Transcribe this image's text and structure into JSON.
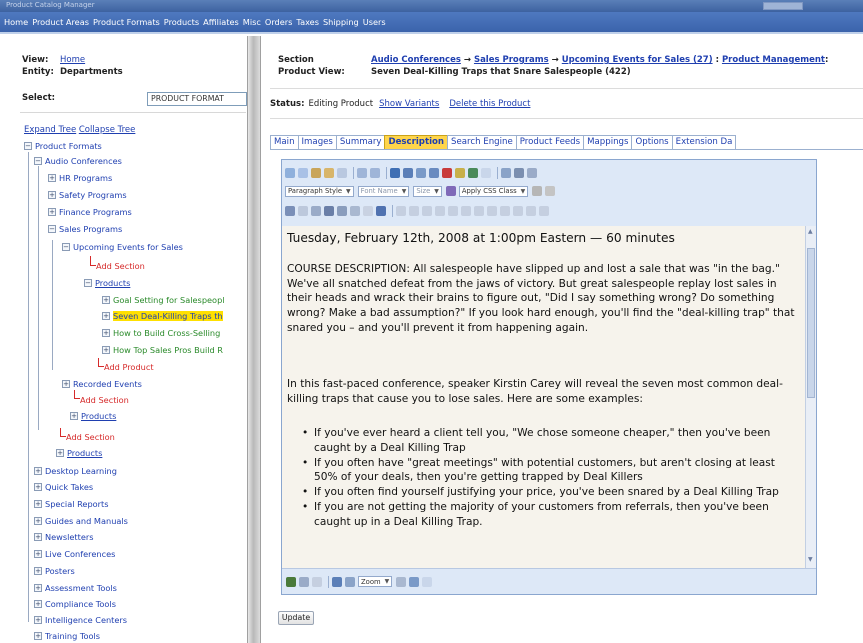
{
  "topbar": {
    "faint_text": "Product Catalog Manager"
  },
  "nav": [
    "Home",
    "Product Areas",
    "Product Formats",
    "Products",
    "Affiliates",
    "Misc",
    "Orders",
    "Taxes",
    "Shipping",
    "Users"
  ],
  "left": {
    "view_label": "View:",
    "view_value": "Home",
    "entity_label": "Entity:",
    "entity_value": "Departments",
    "select_label": "Select:",
    "select_value": "PRODUCT FORMAT",
    "expand_tree": "Expand Tree",
    "collapse_tree": "Collapse Tree",
    "tree": {
      "root": "Product Formats",
      "audio_conferences": "Audio Conferences",
      "hr_programs": "HR Programs",
      "safety_programs": "Safety Programs",
      "finance_programs": "Finance Programs",
      "sales_programs": "Sales Programs",
      "upcoming_events": "Upcoming Events for Sales",
      "add_section_1": "Add Section",
      "products_1": "Products",
      "goal_setting": "Goal Setting for Salespeopl",
      "seven_deal": "Seven Deal-Killing Traps th",
      "cross_selling": "How to Build Cross-Selling",
      "top_sales": "How Top Sales Pros Build R",
      "add_product": "Add Product",
      "recorded_events": "Recorded Events",
      "add_section_2": "Add Section",
      "products_2": "Products",
      "add_section_3": "Add Section",
      "products_3": "Products",
      "desktop_learning": "Desktop Learning",
      "quick_takes": "Quick Takes",
      "special_reports": "Special Reports",
      "guides": "Guides and Manuals",
      "newsletters": "Newsletters",
      "live_conferences": "Live Conferences",
      "posters": "Posters",
      "assessment_tools": "Assessment Tools",
      "compliance_tools": "Compliance Tools",
      "intelligence_centers": "Intelligence Centers",
      "training_tools": "Training Tools"
    }
  },
  "section": {
    "section_label": "Section",
    "product_view_label": "Product View:",
    "crumb_audio": "Audio Conferences",
    "crumb_sales": "Sales Programs",
    "crumb_upcoming": "Upcoming Events for Sales (27)",
    "crumb_product_mgmt": "Product Management",
    "crumb_current": ": Seven Deal-Killing Traps that Snare Salespeople (422)",
    "arrow": "→",
    "colon": ":"
  },
  "status": {
    "label": "Status:",
    "value": "Editing Product",
    "show_variants": "Show Variants",
    "delete_product": "Delete this Product"
  },
  "tabs": [
    "Main",
    "Images",
    "Summary",
    "Description",
    "Search Engine",
    "Product Feeds",
    "Mappings",
    "Options",
    "Extension Da"
  ],
  "active_tab": "Description",
  "toolbar": {
    "paragraph_style": "Paragraph Style",
    "font_name": "Font Name",
    "size": "Size",
    "apply_css": "Apply CSS Class",
    "zoom": "Zoom"
  },
  "content": {
    "heading": "Tuesday, February 12th, 2008 at 1:00pm Eastern — 60 minutes",
    "para1": "COURSE DESCRIPTION: All salespeople have slipped up and lost a sale that was \"in the bag.\" We've all snatched defeat from the jaws of victory. But great salespeople replay lost sales in their heads and wrack their brains to figure out, \"Did I say something wrong? Do something wrong? Make a bad assumption?\" If you look hard enough, you'll find the \"deal-killing trap\" that snared you – and you'll prevent it from happening again.",
    "para2": "In this fast-paced conference, speaker Kirstin Carey will reveal the seven most common deal-killing traps that cause you to lose sales. Here are some examples:",
    "bullets": [
      "If you've ever heard a client tell you, \"We chose someone cheaper,\" then you've been caught by a Deal Killing Trap",
      "If you often have \"great meetings\" with potential customers, but aren't closing at least 50% of your deals, then you're getting trapped by Deal Killers",
      "If you often find yourself justifying your price, you've been snared by a Deal Killing Trap",
      "If you are not getting the majority of your customers from referrals, then you've been caught up in a Deal Killing Trap."
    ]
  },
  "update_button": "Update",
  "colors": {
    "nav": "#3b63ab",
    "link": "#1f3fb0",
    "red": "#d62a2a",
    "highlight": "#ffe000",
    "active_tab": "#ffd54a"
  }
}
